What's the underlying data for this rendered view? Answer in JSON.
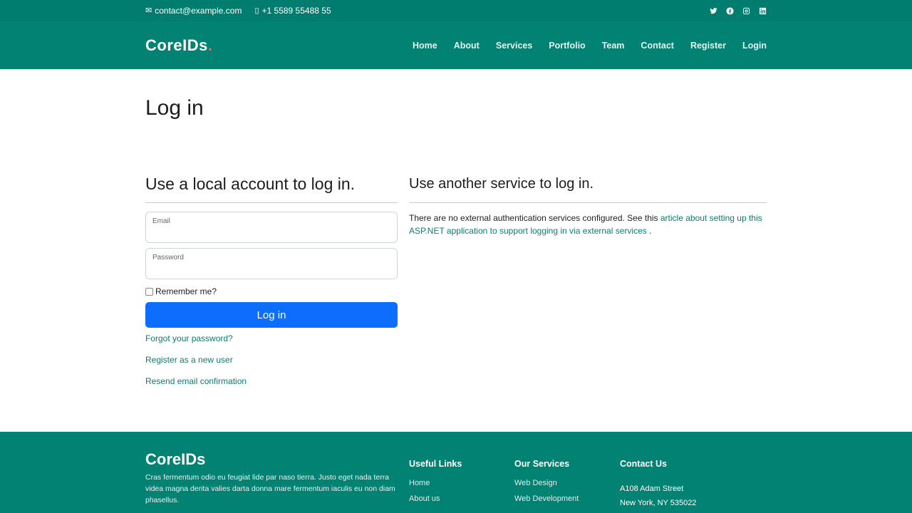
{
  "topbar": {
    "email": "contact@example.com",
    "phone": "+1 5589 55488 55",
    "social": [
      "twitter-icon",
      "facebook-icon",
      "instagram-icon",
      "linkedin-icon"
    ]
  },
  "header": {
    "logo": "CoreIDs",
    "logo_dot": ".",
    "nav": [
      "Home",
      "About",
      "Services",
      "Portfolio",
      "Team",
      "Contact",
      "Register",
      "Login"
    ]
  },
  "main": {
    "title": "Log in",
    "local": {
      "heading": "Use a local account to log in.",
      "email_label": "Email",
      "email_value": "",
      "password_label": "Password",
      "password_value": "",
      "remember_label": "Remember me?",
      "submit_label": "Log in",
      "forgot_link": "Forgot your password?",
      "register_link": "Register as a new user",
      "resend_link": "Resend email confirmation"
    },
    "external": {
      "heading": "Use another service to log in.",
      "text_before": "There are no external authentication services configured. See this ",
      "link_text": "article about setting up this ASP.NET application to support logging in via external services",
      "text_after": " ."
    }
  },
  "footer": {
    "logo": "CoreIDs",
    "description": "Cras fermentum odio eu feugiat lide par naso tierra. Justo eget nada terra videa magna derita valies darta donna mare fermentum iaculis eu non diam phasellus.",
    "useful_links": {
      "heading": "Useful Links",
      "items": [
        "Home",
        "About us"
      ]
    },
    "services": {
      "heading": "Our Services",
      "items": [
        "Web Design",
        "Web Development"
      ]
    },
    "contact": {
      "heading": "Contact Us",
      "line1": "A108 Adam Street",
      "line2": "New York, NY 535022"
    }
  },
  "colors": {
    "topbar": "#017d70",
    "header": "#018272",
    "primary_button": "#0d6efd",
    "link": "#0b7d72",
    "logo_dot": "#e96b56"
  }
}
